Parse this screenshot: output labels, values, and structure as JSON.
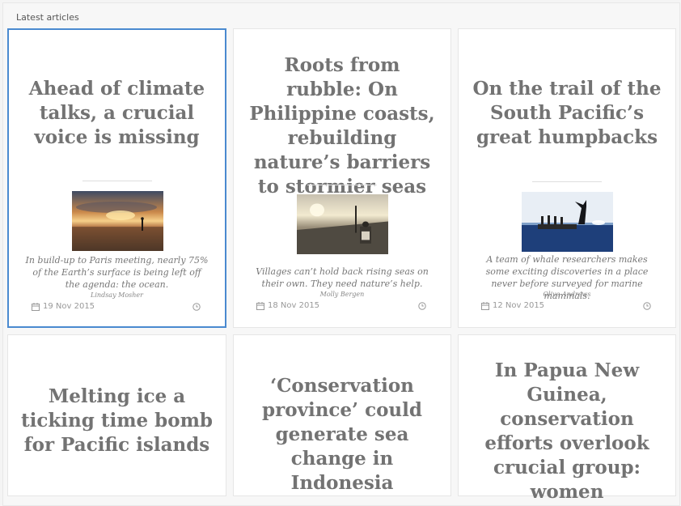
{
  "header": {
    "title": "Latest articles"
  },
  "cards": [
    {
      "title": "Ahead of climate talks, a crucial voice is missing",
      "excerpt": "In build-up to Paris meeting, nearly 75% of the Earth’s surface is being left off the agenda: the ocean.",
      "author": "Lindsay Mosher",
      "date": "19 Nov 2015",
      "icons": {
        "date": "calendar-icon",
        "time": "clock-icon"
      },
      "image": "sunset-beach"
    },
    {
      "title": "Roots from rubble: On Philippine coasts, rebuilding nature’s barriers to stormier seas",
      "excerpt": "Villages can’t hold back rising seas on their own. They need nature’s help.",
      "author": "Molly Bergen",
      "date": "18 Nov 2015",
      "icons": {
        "date": "calendar-icon",
        "time": "clock-icon"
      },
      "image": "coastal-village"
    },
    {
      "title": "On the trail of the South Pacific’s great humpbacks",
      "excerpt": "A team of whale researchers makes some exciting discoveries in a place never before surveyed for marine mammals.",
      "author": "Olive Andrews",
      "date": "12 Nov 2015",
      "icons": {
        "date": "calendar-icon",
        "time": "clock-icon"
      },
      "image": "whale-tail-boat"
    },
    {
      "title": "Melting ice a ticking time bomb for Pacific islands"
    },
    {
      "title": "‘Conservation province’ could generate sea change in Indonesia"
    },
    {
      "title": "In Papua New Guinea, conservation efforts overlook crucial group: women"
    }
  ],
  "colors": {
    "selected_border": "#4a8ad0",
    "title": "#737373"
  }
}
